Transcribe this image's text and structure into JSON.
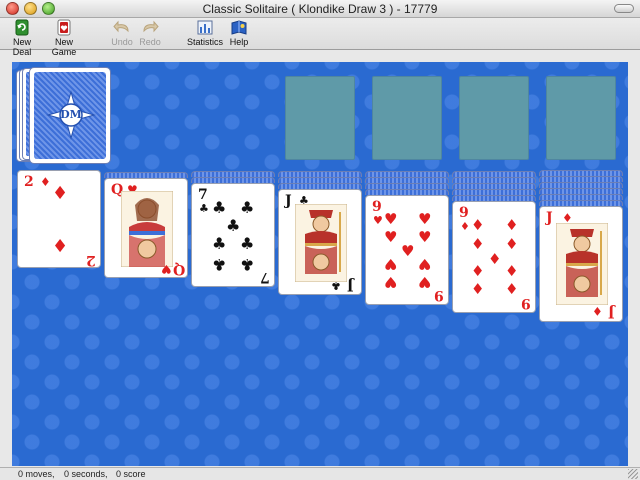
{
  "window": {
    "title": "Classic Solitaire ( Klondike Draw 3 ) - 17779"
  },
  "toolbar": {
    "new_deal": "New Deal",
    "new_game": "New Game",
    "undo": "Undo",
    "redo": "Redo",
    "statistics": "Statistics",
    "help": "Help"
  },
  "stock": {
    "logo_text": "DM"
  },
  "tableau": [
    {
      "rank": "2",
      "suit": "♦",
      "color": "red",
      "face_down": 0
    },
    {
      "rank": "Q",
      "suit": "♥",
      "color": "red",
      "face_down": 1
    },
    {
      "rank": "7",
      "suit": "♣",
      "color": "black",
      "face_down": 2
    },
    {
      "rank": "J",
      "suit": "♣",
      "color": "black",
      "face_down": 3
    },
    {
      "rank": "9",
      "suit": "♥",
      "color": "red",
      "face_down": 4
    },
    {
      "rank": "9",
      "suit": "♦",
      "color": "red",
      "face_down": 5
    },
    {
      "rank": "J",
      "suit": "♦",
      "color": "red",
      "face_down": 6
    }
  ],
  "status": {
    "moves": "0 moves,",
    "seconds": "0 seconds,",
    "score": "0 score"
  },
  "colors": {
    "felt": "#2a6ad1",
    "foundation": "#5f9aa8",
    "red_suit": "#e02020"
  }
}
